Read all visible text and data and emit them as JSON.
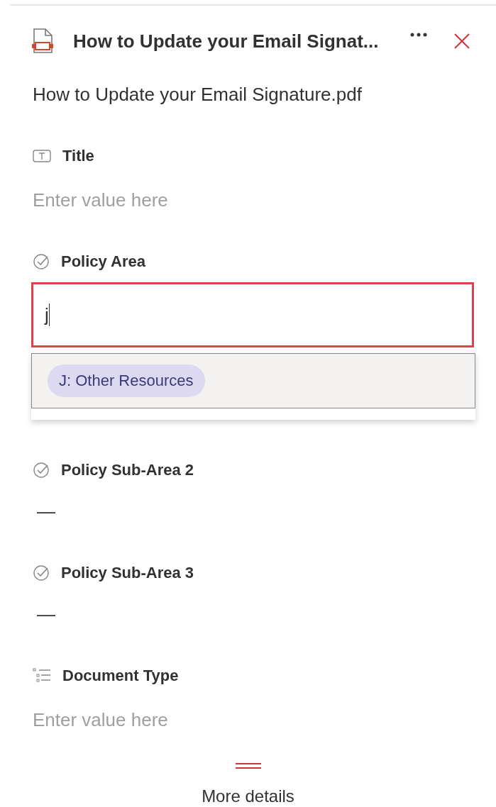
{
  "header": {
    "title": "How to Update your Email Signat..."
  },
  "file_name": "How to Update your Email Signature.pdf",
  "fields": [
    {
      "kind": "text",
      "label": "Title",
      "placeholder": "Enter value here"
    },
    {
      "kind": "input",
      "label": "Policy Area",
      "value": "j",
      "suggestions": [
        "J: Other Resources"
      ]
    },
    {
      "kind": "choice",
      "label": "Policy Sub-Area 2",
      "value": "—"
    },
    {
      "kind": "choice",
      "label": "Policy Sub-Area 3",
      "value": "—"
    },
    {
      "kind": "list",
      "label": "Document Type",
      "placeholder": "Enter value here"
    }
  ],
  "more_details": "More details"
}
